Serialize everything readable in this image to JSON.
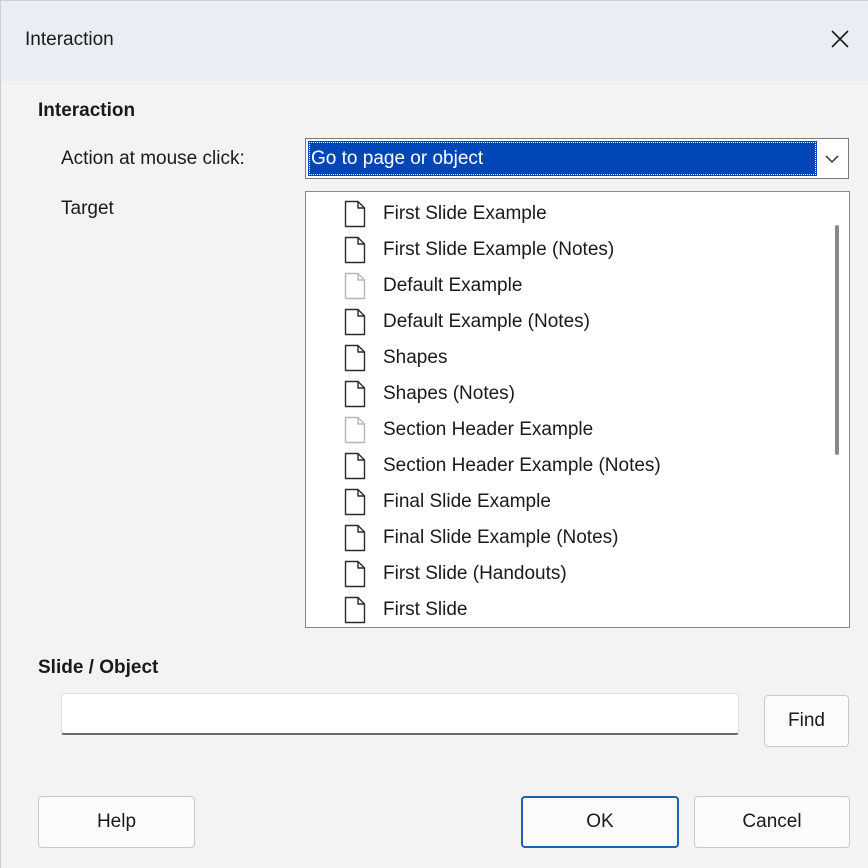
{
  "window": {
    "title": "Interaction"
  },
  "interaction": {
    "heading": "Interaction",
    "action_label": "Action at mouse click:",
    "action_value": "Go to page or object",
    "target_label": "Target",
    "targets": [
      {
        "label": "First Slide Example",
        "icon": "document-icon",
        "dim": false
      },
      {
        "label": "First Slide Example (Notes)",
        "icon": "document-icon",
        "dim": false
      },
      {
        "label": "Default Example",
        "icon": "document-icon",
        "dim": true
      },
      {
        "label": "Default Example (Notes)",
        "icon": "document-icon",
        "dim": false
      },
      {
        "label": "Shapes",
        "icon": "document-icon",
        "dim": false
      },
      {
        "label": "Shapes (Notes)",
        "icon": "document-icon",
        "dim": false
      },
      {
        "label": "Section Header Example",
        "icon": "document-icon",
        "dim": true
      },
      {
        "label": "Section Header Example (Notes)",
        "icon": "document-icon",
        "dim": false
      },
      {
        "label": "Final Slide Example",
        "icon": "document-icon",
        "dim": false
      },
      {
        "label": "Final Slide Example (Notes)",
        "icon": "document-icon",
        "dim": false
      },
      {
        "label": "First Slide (Handouts)",
        "icon": "document-icon",
        "dim": false
      },
      {
        "label": "First Slide",
        "icon": "document-icon",
        "dim": false
      }
    ]
  },
  "slide_object": {
    "heading": "Slide / Object",
    "value": "",
    "find_label": "Find"
  },
  "footer": {
    "help_label": "Help",
    "ok_label": "OK",
    "cancel_label": "Cancel"
  },
  "colors": {
    "selection": "#0046b7",
    "default_button_border": "#1f5fb0"
  }
}
